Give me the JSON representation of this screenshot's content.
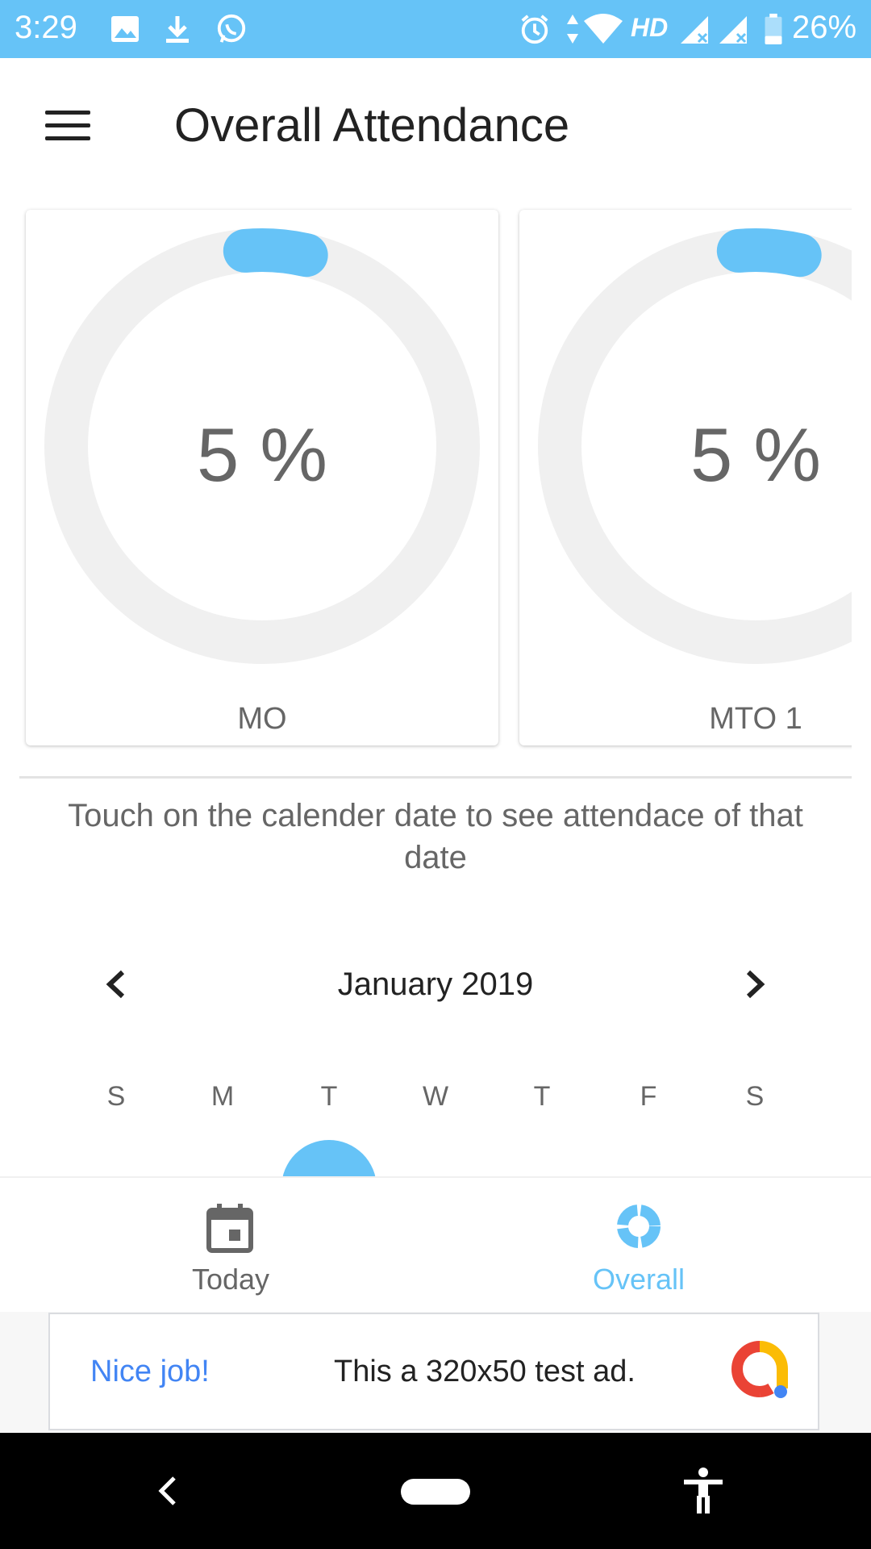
{
  "status_bar": {
    "time": "3:29",
    "network": "HD",
    "battery": "26%",
    "icons": [
      "image-icon",
      "download-icon",
      "whatsapp-icon",
      "alarm-icon",
      "data-arrows-icon",
      "wifi-icon",
      "signal-icon",
      "signal-icon",
      "battery-icon"
    ]
  },
  "header": {
    "title": "Overall Attendance",
    "menu_icon": "hamburger-menu-icon"
  },
  "cards": [
    {
      "label": "MO",
      "percent_text": "5 %",
      "percent": 5
    },
    {
      "label": "MTO 1",
      "percent_text": "5 %",
      "percent": 5
    }
  ],
  "hint": "Touch on the calender date to see attendace of that date",
  "calendar": {
    "month_label": "January 2019",
    "weekdays": [
      "S",
      "M",
      "T",
      "W",
      "T",
      "F",
      "S"
    ]
  },
  "bottom_nav": {
    "items": [
      {
        "label": "Today",
        "icon": "calendar-icon",
        "active": false
      },
      {
        "label": "Overall",
        "icon": "donut-chart-icon",
        "active": true
      }
    ]
  },
  "ad": {
    "headline": "Nice job!",
    "text": "This a 320x50 test ad."
  },
  "colors": {
    "accent": "#66c3f7",
    "ring_track": "#f0f0f0",
    "text_muted": "#666666"
  }
}
